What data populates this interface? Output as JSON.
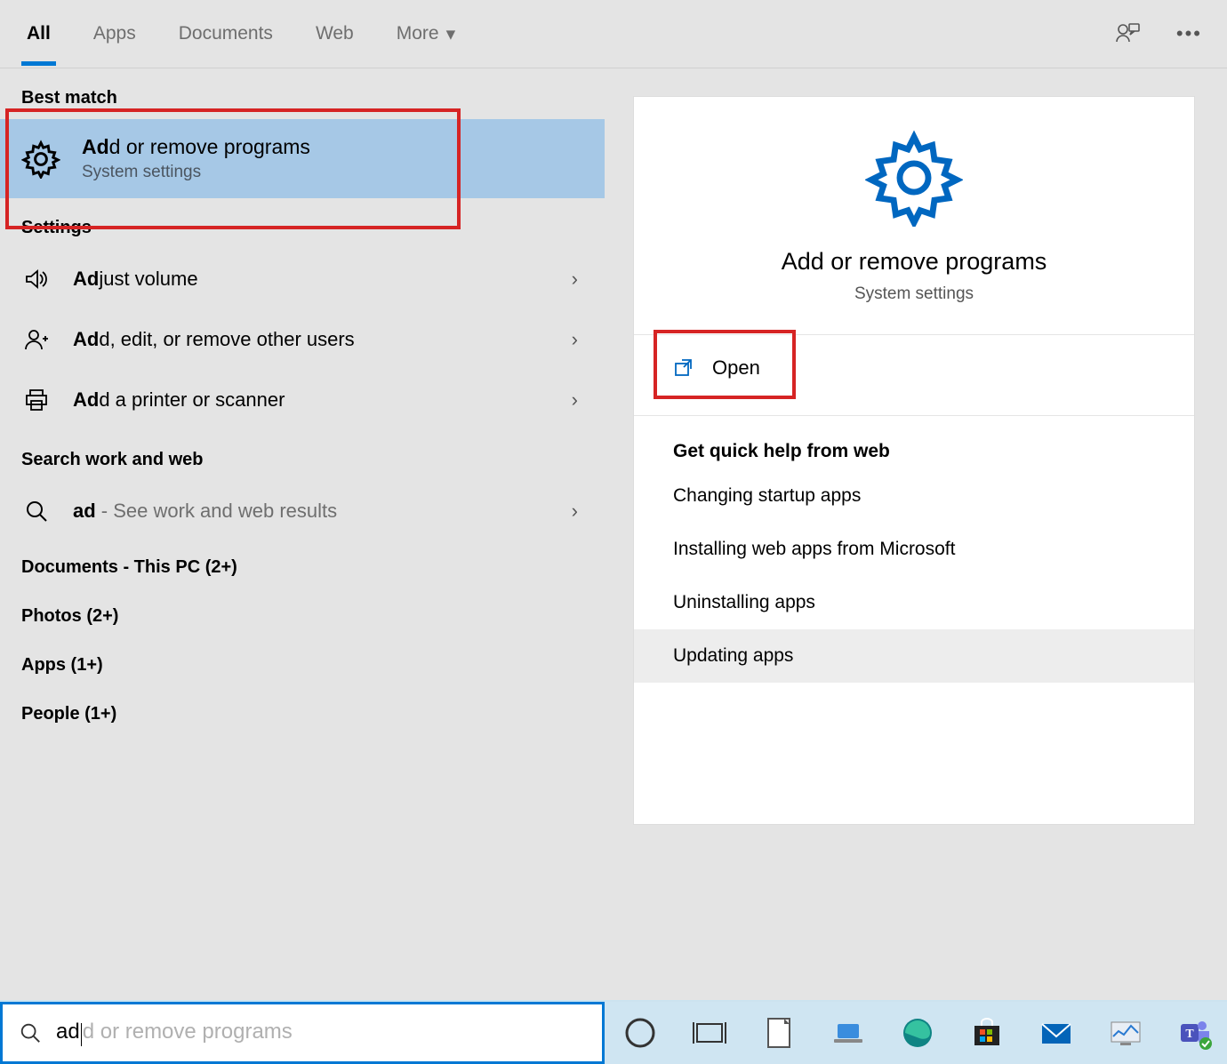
{
  "tabs": {
    "all": "All",
    "apps": "Apps",
    "documents": "Documents",
    "web": "Web",
    "more": "More"
  },
  "sections": {
    "best_match": "Best match",
    "settings": "Settings",
    "search_web": "Search work and web",
    "docs": "Documents - This PC (2+)",
    "photos": "Photos (2+)",
    "apps": "Apps (1+)",
    "people": "People (1+)"
  },
  "best_match_item": {
    "title_bold": "Ad",
    "title_rest": "d or remove programs",
    "subtitle": "System settings"
  },
  "settings_items": [
    {
      "bold": "Ad",
      "rest": "just volume",
      "icon": "volume"
    },
    {
      "bold": "Ad",
      "rest": "d, edit, or remove other users",
      "icon": "user-add"
    },
    {
      "bold": "Ad",
      "rest": "d a printer or scanner",
      "icon": "printer"
    }
  ],
  "web_item": {
    "bold": "ad",
    "hint": " - See work and web results"
  },
  "detail": {
    "title": "Add or remove programs",
    "subtitle": "System settings",
    "open_label": "Open"
  },
  "quick_help": {
    "header": "Get quick help from web",
    "links": [
      "Changing startup apps",
      "Installing web apps from Microsoft",
      "Uninstalling apps",
      "Updating apps"
    ]
  },
  "searchbox": {
    "typed": "ad",
    "ghost": "d or remove programs"
  }
}
